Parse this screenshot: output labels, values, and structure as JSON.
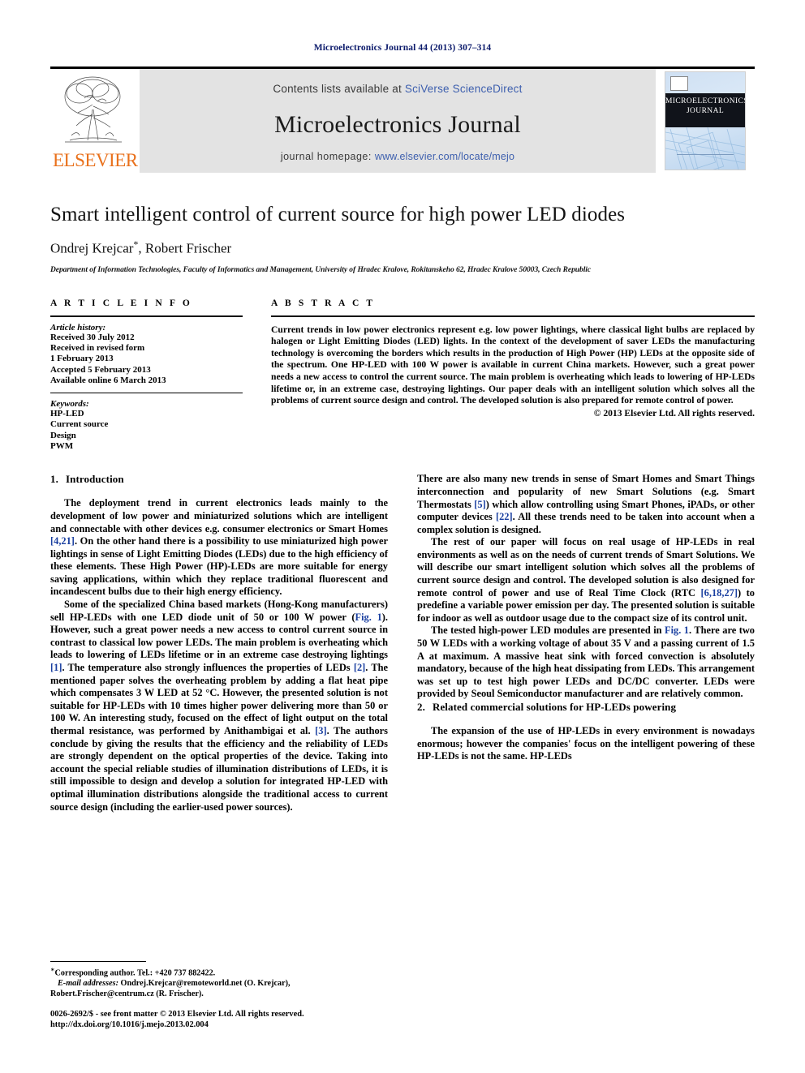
{
  "running_head": "Microelectronics Journal 44 (2013) 307–314",
  "masthead": {
    "publisher_name": "ELSEVIER",
    "contents_prefix": "Contents lists available at ",
    "contents_link": "SciVerse ScienceDirect",
    "journal_title": "Microelectronics Journal",
    "homepage_prefix": "journal homepage: ",
    "homepage_link": "www.elsevier.com/locate/mejo",
    "cover_title_line1": "MICROELECTRONICS",
    "cover_title_line2": "JOURNAL"
  },
  "article": {
    "title": "Smart intelligent control of current source for high power LED diodes",
    "authors": "Ondrej Krejcar",
    "author_marker": "*",
    "authors_rest": ", Robert Frischer",
    "affiliation": "Department of Information Technologies, Faculty of Informatics and Management, University of Hradec Kralove, Rokitanskeho 62, Hradec Kralove 50003, Czech Republic"
  },
  "article_info": {
    "heading": "A R T I C L E   I N F O",
    "history_label": "Article history:",
    "history": [
      "Received 30 July 2012",
      "Received in revised form",
      "1 February 2013",
      "Accepted 5 February 2013",
      "Available online 6 March 2013"
    ],
    "keywords_label": "Keywords:",
    "keywords": [
      "HP-LED",
      "Current source",
      "Design",
      "PWM"
    ]
  },
  "abstract": {
    "heading": "A B S T R A C T",
    "text": "Current trends in low power electronics represent e.g. low power lightings, where classical light bulbs are replaced by halogen or Light Emitting Diodes (LED) lights. In the context of the development of saver LEDs the manufacturing technology is overcoming the borders which results in the production of High Power (HP) LEDs at the opposite side of the spectrum. One HP-LED with 100 W power is available in current China markets. However, such a great power needs a new access to control the current source. The main problem is overheating which leads to lowering of HP-LEDs lifetime or, in an extreme case, destroying lightings. Our paper deals with an intelligent solution which solves all the problems of current source design and control. The developed solution is also prepared for remote control of power.",
    "copyright": "© 2013 Elsevier Ltd. All rights reserved."
  },
  "sections": {
    "intro": {
      "number": "1.",
      "title": "Introduction",
      "p1_a": "The deployment trend in current electronics leads mainly to the development of low power and miniaturized solutions which are intelligent and connectable with other devices e.g. consumer electronics or Smart Homes ",
      "p1_ref": "[4,21]",
      "p1_b": ". On the other hand there is a possibility to use miniaturized high power lightings in sense of Light Emitting Diodes (LEDs) due to the high efficiency of these elements. These High Power (HP)-LEDs are more suitable for energy saving applications, within which they replace traditional fluorescent and incandescent bulbs due to their high energy efficiency.",
      "p2_a": "Some of the specialized China based markets (Hong-Kong manufacturers) sell HP-LEDs with one LED diode unit of 50 or 100 W power (",
      "p2_fig": "Fig. 1",
      "p2_b": "). However, such a great power needs a new access to control current source in contrast to classical low power LEDs. The main problem is overheating which leads to lowering of LEDs lifetime or in an extreme case destroying lightings ",
      "p2_ref1": "[1]",
      "p2_c": ". The temperature also strongly influences the properties of LEDs ",
      "p2_ref2": "[2]",
      "p2_d": ". The mentioned paper solves the overheating problem by adding a flat heat pipe which compensates 3 W LED at 52 °C. However, the presented solution is not suitable for HP-LEDs with 10 times higher power delivering more than 50 or 100 W. An interesting study, focused on the effect of light output on the total thermal resistance, was performed by Anithambigai et al. ",
      "p2_ref3": "[3]",
      "p2_e": ". The authors conclude by giving the results that the efficiency and the reliability of LEDs are strongly dependent on the optical properties of the device. Taking into account the special reliable studies of illumination distributions of LEDs, it is still impossible to design and develop a solution for integrated HP-LED with optimal illumination distributions alongside the traditional access to current source design (including the earlier-used power sources).",
      "p3_a": "There are also many new trends in sense of Smart Homes and Smart Things interconnection and popularity of new Smart Solutions (e.g. Smart Thermostats ",
      "p3_ref1": "[5]",
      "p3_b": ") which allow controlling using Smart Phones, iPADs, or other computer devices ",
      "p3_ref2": "[22]",
      "p3_c": ". All these trends need to be taken into account when a complex solution is designed.",
      "p4_a": "The rest of our paper will focus on real usage of HP-LEDs in real environments as well as on the needs of current trends of Smart Solutions. We will describe our smart intelligent solution which solves all the problems of current source design and control. The developed solution is also designed for remote control of power and use of Real Time Clock (RTC ",
      "p4_ref": "[6,18,27]",
      "p4_b": ") to predefine a variable power emission per day. The presented solution is suitable for indoor as well as outdoor usage due to the compact size of its control unit.",
      "p5_a": "The tested high-power LED modules are presented in ",
      "p5_fig": "Fig. 1",
      "p5_b": ". There are two 50 W LEDs with a working voltage of about 35 V and a passing current of 1.5 A at maximum. A massive heat sink with forced convection is absolutely mandatory, because of the high heat dissipating from LEDs. This arrangement was set up to test high power LEDs and DC/DC converter. LEDs were provided by Seoul Semiconductor manufacturer and are relatively common."
    },
    "related": {
      "number": "2.",
      "title": "Related commercial solutions for HP-LEDs powering",
      "p1": "The expansion of the use of HP-LEDs in every environment is nowadays enormous; however the companies' focus on the intelligent powering of these HP-LEDs is not the same. HP-LEDs"
    }
  },
  "footnotes": {
    "corresponding": "Corresponding author. Tel.: +420 737 882422.",
    "email_label": "E-mail addresses:",
    "email_1": " Ondrej.Krejcar@remoteworld.net (O. Krejcar),",
    "email_2": "Robert.Frischer@centrum.cz (R. Frischer).",
    "issn_line": "0026-2692/$ - see front matter © 2013 Elsevier Ltd. All rights reserved.",
    "doi_line": "http://dx.doi.org/10.1016/j.mejo.2013.02.004"
  }
}
